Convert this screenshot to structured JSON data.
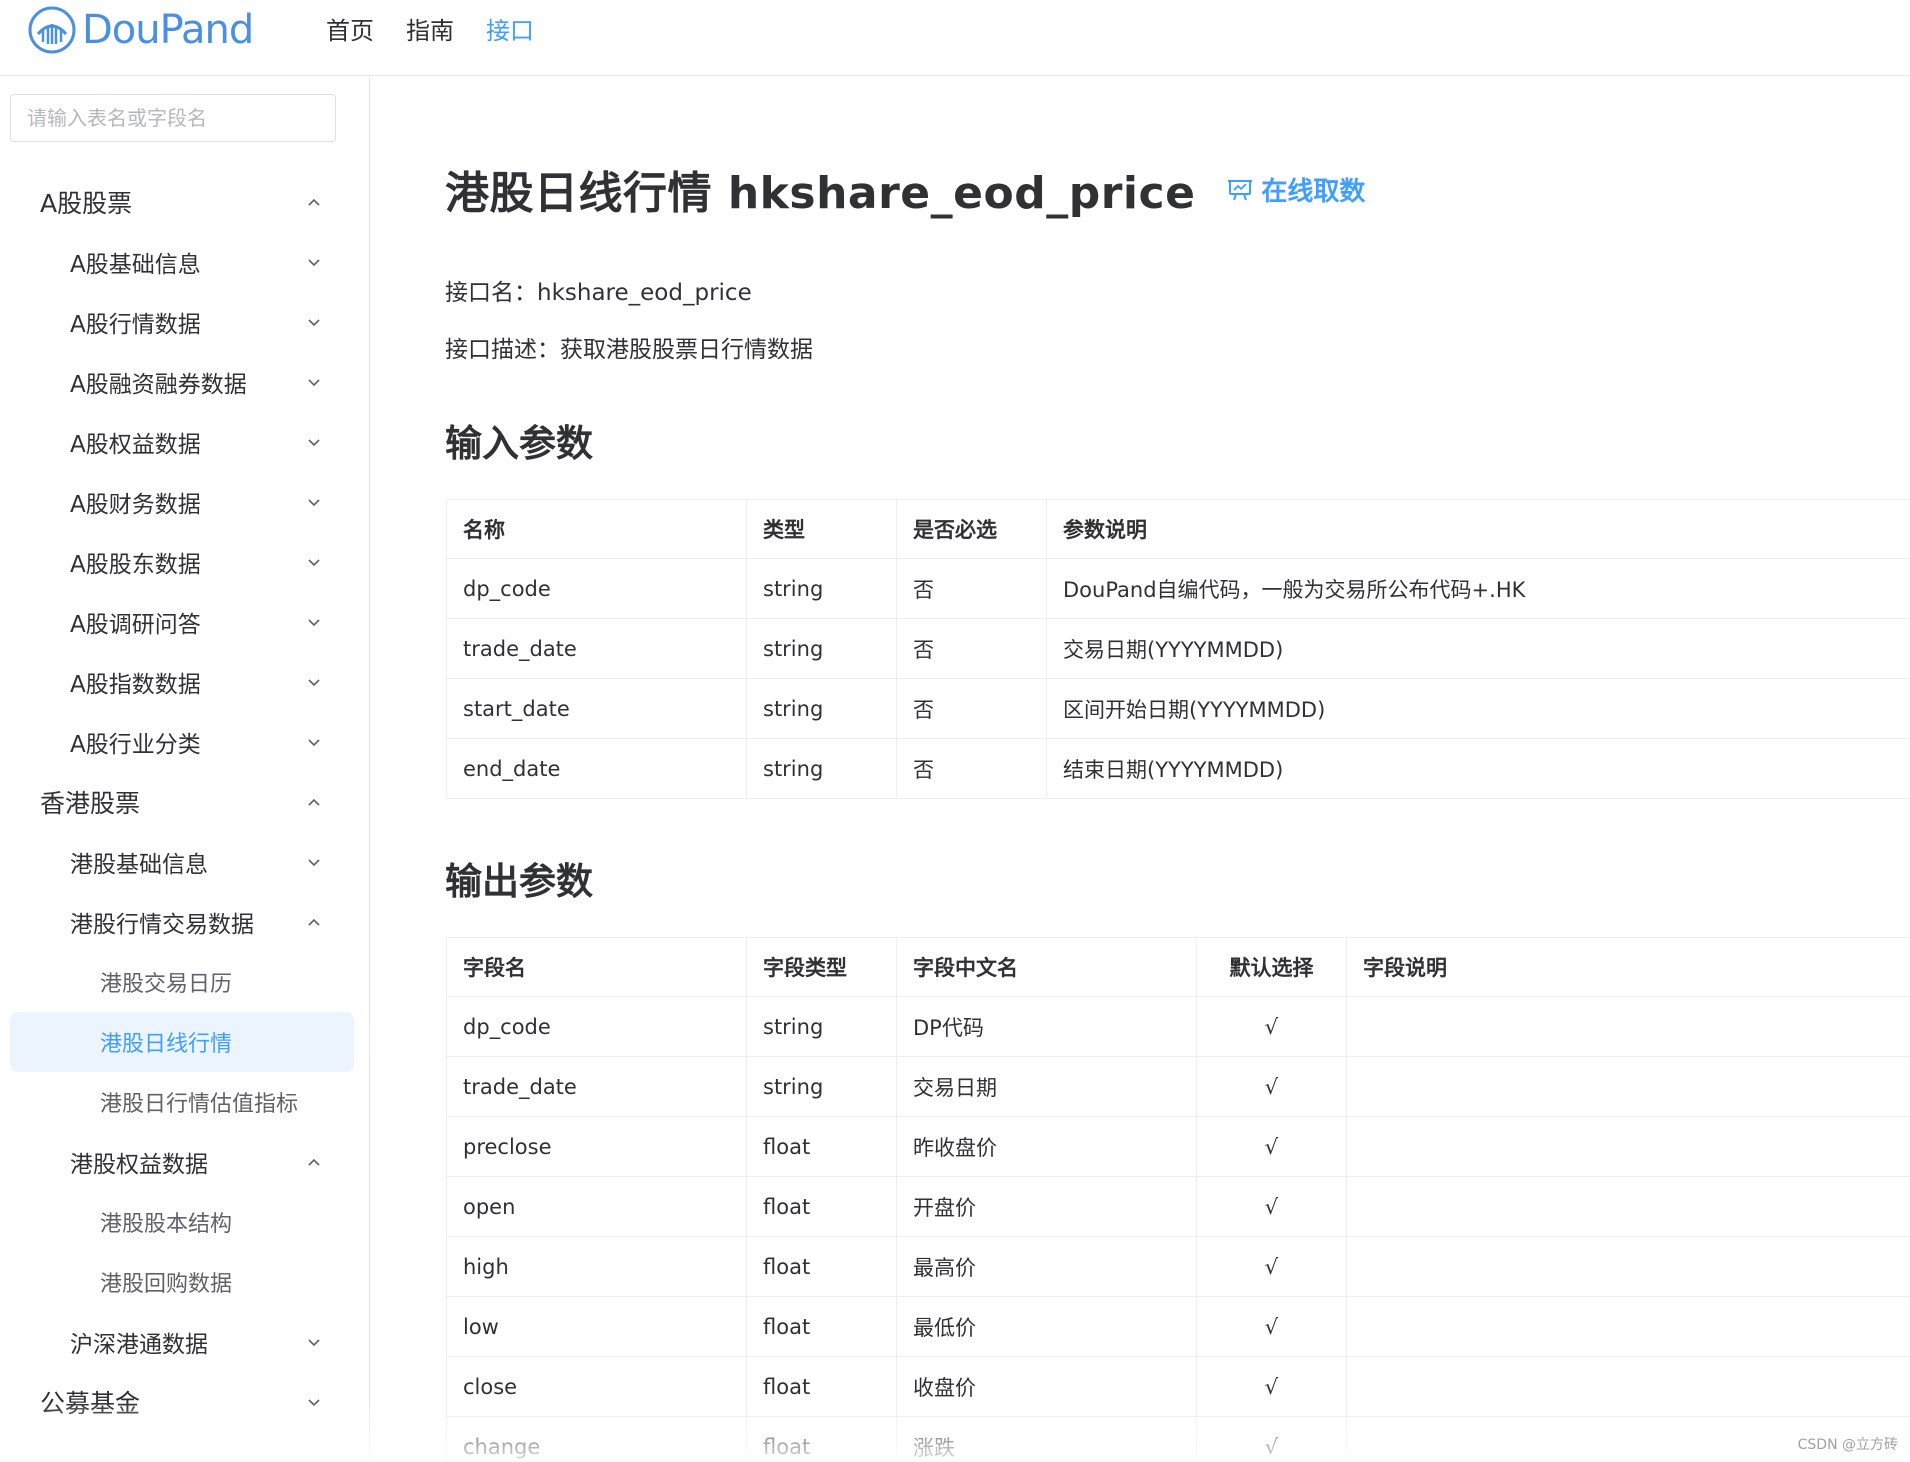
{
  "brand": {
    "name": "DouPand"
  },
  "nav": [
    {
      "label": "首页",
      "active": false
    },
    {
      "label": "指南",
      "active": false
    },
    {
      "label": "接口",
      "active": true
    }
  ],
  "sidebar": {
    "search_placeholder": "请输入表名或字段名",
    "items": [
      {
        "label": "A股股票",
        "level": 1,
        "state": "expanded"
      },
      {
        "label": "A股基础信息",
        "level": 2,
        "state": "collapsed"
      },
      {
        "label": "A股行情数据",
        "level": 2,
        "state": "collapsed"
      },
      {
        "label": "A股融资融券数据",
        "level": 2,
        "state": "collapsed"
      },
      {
        "label": "A股权益数据",
        "level": 2,
        "state": "collapsed"
      },
      {
        "label": "A股财务数据",
        "level": 2,
        "state": "collapsed"
      },
      {
        "label": "A股股东数据",
        "level": 2,
        "state": "collapsed"
      },
      {
        "label": "A股调研问答",
        "level": 2,
        "state": "collapsed"
      },
      {
        "label": "A股指数数据",
        "level": 2,
        "state": "collapsed"
      },
      {
        "label": "A股行业分类",
        "level": 2,
        "state": "collapsed"
      },
      {
        "label": "香港股票",
        "level": 1,
        "state": "expanded"
      },
      {
        "label": "港股基础信息",
        "level": 2,
        "state": "collapsed"
      },
      {
        "label": "港股行情交易数据",
        "level": 2,
        "state": "expanded"
      },
      {
        "label": "港股交易日历",
        "level": 3,
        "state": "leaf"
      },
      {
        "label": "港股日线行情",
        "level": 3,
        "state": "leaf",
        "selected": true
      },
      {
        "label": "港股日行情估值指标",
        "level": 3,
        "state": "leaf"
      },
      {
        "label": "港股权益数据",
        "level": 2,
        "state": "expanded"
      },
      {
        "label": "港股股本结构",
        "level": 3,
        "state": "leaf"
      },
      {
        "label": "港股回购数据",
        "level": 3,
        "state": "leaf"
      },
      {
        "label": "沪深港通数据",
        "level": 2,
        "state": "collapsed"
      },
      {
        "label": "公募基金",
        "level": 1,
        "state": "collapsed"
      }
    ]
  },
  "main": {
    "title": "港股日线行情 hkshare_eod_price",
    "online_link": "在线取数",
    "api_name_label": "接口名：",
    "api_name": "hkshare_eod_price",
    "api_desc_label": "接口描述：",
    "api_desc": "获取港股股票日行情数据",
    "input_heading": "输入参数",
    "input_table": {
      "headers": [
        "名称",
        "类型",
        "是否必选",
        "参数说明"
      ],
      "rows": [
        [
          "dp_code",
          "string",
          "否",
          "DouPand自编代码，一般为交易所公布代码+.HK"
        ],
        [
          "trade_date",
          "string",
          "否",
          "交易日期(YYYYMMDD)"
        ],
        [
          "start_date",
          "string",
          "否",
          "区间开始日期(YYYYMMDD)"
        ],
        [
          "end_date",
          "string",
          "否",
          "结束日期(YYYYMMDD)"
        ]
      ]
    },
    "output_heading": "输出参数",
    "output_table": {
      "headers": [
        "字段名",
        "字段类型",
        "字段中文名",
        "默认选择",
        "字段说明"
      ],
      "rows": [
        [
          "dp_code",
          "string",
          "DP代码",
          "√",
          ""
        ],
        [
          "trade_date",
          "string",
          "交易日期",
          "√",
          ""
        ],
        [
          "preclose",
          "float",
          "昨收盘价",
          "√",
          ""
        ],
        [
          "open",
          "float",
          "开盘价",
          "√",
          ""
        ],
        [
          "high",
          "float",
          "最高价",
          "√",
          ""
        ],
        [
          "low",
          "float",
          "最低价",
          "√",
          ""
        ],
        [
          "close",
          "float",
          "收盘价",
          "√",
          ""
        ],
        [
          "change",
          "float",
          "涨跌",
          "√",
          ""
        ]
      ]
    }
  },
  "watermark": "CSDN @立方砖",
  "colors": {
    "accent": "#409eff",
    "selected_bg": "#ecf5ff",
    "border": "#ebeef5"
  }
}
